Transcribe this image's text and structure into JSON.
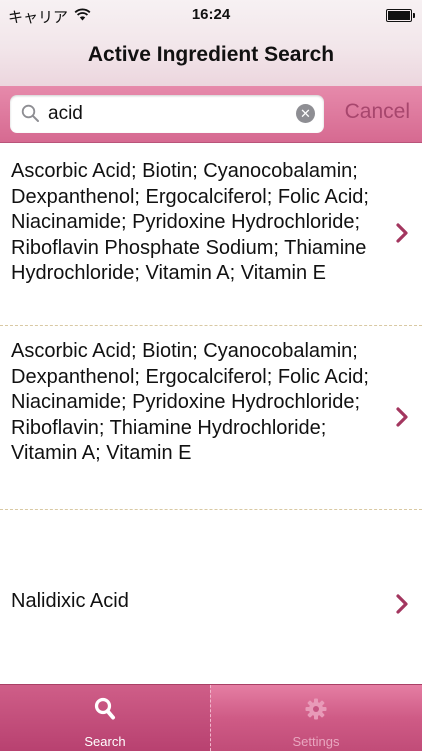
{
  "status_bar": {
    "carrier": "キャリア",
    "time": "16:24",
    "icons": {
      "wifi": "wifi-icon",
      "battery": "battery-icon"
    }
  },
  "nav": {
    "title": "Active Ingredient Search"
  },
  "search": {
    "value": "acid",
    "cancel_label": "Cancel",
    "icons": {
      "search": "magnifier-icon",
      "clear": "clear-icon"
    }
  },
  "results": [
    {
      "text": "Ascorbic Acid; Biotin; Cyanocobalamin; Dexpanthenol; Ergocalciferol; Folic Acid; Niacinamide; Pyridoxine Hydrochloride; Riboflavin Phosphate Sodium; Thiamine Hydrochloride; Vitamin A; Vitamin E"
    },
    {
      "text": "Ascorbic Acid; Biotin; Cyanocobalamin; Dexpanthenol; Ergocalciferol; Folic Acid; Niacinamide; Pyridoxine Hydrochloride; Riboflavin; Thiamine Hydrochloride; Vitamin A; Vitamin E"
    },
    {
      "text": "Nalidixic Acid"
    }
  ],
  "tabs": [
    {
      "label": "Search",
      "icon": "search-icon",
      "selected": true
    },
    {
      "label": "Settings",
      "icon": "gear-icon",
      "selected": false
    }
  ],
  "colors": {
    "accent": "#d66a91",
    "chevron": "#a3365f",
    "separator": "#d9c9a3",
    "cancel_text": "#a7466d"
  }
}
